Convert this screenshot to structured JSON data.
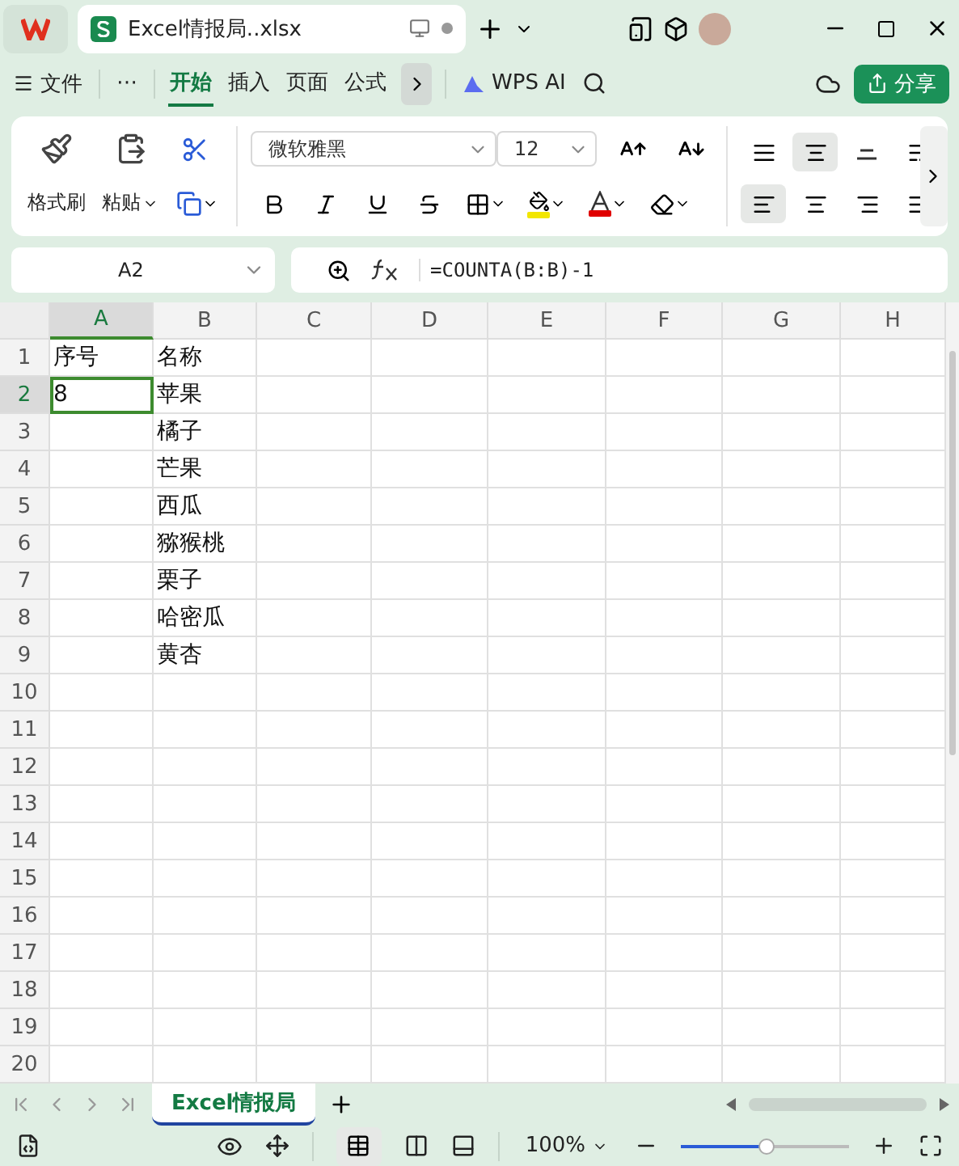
{
  "document_tab": {
    "title": "Excel情报局..xlsx"
  },
  "menu": {
    "file": "文件",
    "more": "⋯",
    "tabs": [
      {
        "label": "开始",
        "selected": true
      },
      {
        "label": "插入",
        "selected": false
      },
      {
        "label": "页面",
        "selected": false
      },
      {
        "label": "公式",
        "selected": false
      }
    ],
    "ai": "WPS AI",
    "share": "分享"
  },
  "ribbon": {
    "format_painter": "格式刷",
    "paste": "粘贴",
    "font": "微软雅黑",
    "size": "12",
    "align_buttons": [
      {
        "selected": false
      },
      {
        "selected": true
      },
      {
        "selected": false
      },
      {
        "selected": false
      },
      {
        "selected": true
      },
      {
        "selected": false
      },
      {
        "selected": false
      },
      {
        "selected": false
      }
    ]
  },
  "formula_bar": {
    "name_box": "A2",
    "formula": "=COUNTA(B:B)-1"
  },
  "columns": [
    {
      "label": "A",
      "selected": true
    },
    {
      "label": "B",
      "selected": false
    },
    {
      "label": "C",
      "selected": false
    },
    {
      "label": "D",
      "selected": false
    },
    {
      "label": "E",
      "selected": false
    },
    {
      "label": "F",
      "selected": false
    },
    {
      "label": "G",
      "selected": false
    },
    {
      "label": "H",
      "selected": false
    }
  ],
  "rows": [
    {
      "label": "1",
      "selected": false,
      "cells": [
        "序号",
        "名称"
      ]
    },
    {
      "label": "2",
      "selected": true,
      "cells": [
        "8",
        "苹果"
      ]
    },
    {
      "label": "3",
      "selected": false,
      "cells": [
        "",
        "橘子"
      ]
    },
    {
      "label": "4",
      "selected": false,
      "cells": [
        "",
        "芒果"
      ]
    },
    {
      "label": "5",
      "selected": false,
      "cells": [
        "",
        "西瓜"
      ]
    },
    {
      "label": "6",
      "selected": false,
      "cells": [
        "",
        "猕猴桃"
      ]
    },
    {
      "label": "7",
      "selected": false,
      "cells": [
        "",
        "栗子"
      ]
    },
    {
      "label": "8",
      "selected": false,
      "cells": [
        "",
        "哈密瓜"
      ]
    },
    {
      "label": "9",
      "selected": false,
      "cells": [
        "",
        "黄杏"
      ]
    },
    {
      "label": "10",
      "selected": false,
      "cells": []
    },
    {
      "label": "11",
      "selected": false,
      "cells": []
    },
    {
      "label": "12",
      "selected": false,
      "cells": []
    },
    {
      "label": "13",
      "selected": false,
      "cells": []
    },
    {
      "label": "14",
      "selected": false,
      "cells": []
    },
    {
      "label": "15",
      "selected": false,
      "cells": []
    },
    {
      "label": "16",
      "selected": false,
      "cells": []
    },
    {
      "label": "17",
      "selected": false,
      "cells": []
    },
    {
      "label": "18",
      "selected": false,
      "cells": []
    },
    {
      "label": "19",
      "selected": false,
      "cells": []
    },
    {
      "label": "20",
      "selected": false,
      "cells": []
    }
  ],
  "sheet_tabs": [
    {
      "label": "Excel情报局",
      "selected": true
    }
  ],
  "status_bar": {
    "zoom": "100%",
    "zoom_slider": {
      "level": 0.51
    }
  }
}
